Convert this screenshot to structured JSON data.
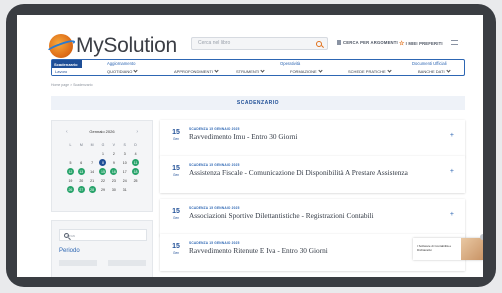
{
  "header": {
    "logo_text": "MySolution",
    "search_placeholder": "Cerca nel libro",
    "links": [
      "CERCA PER ARGOMENTI",
      "I MIEI PREFERITI"
    ]
  },
  "nav": {
    "chip_top": "Scadenzario",
    "chip_bottom": "Lavoro",
    "groups": [
      "Aggiornamento",
      "Operatività",
      "Documenti Ufficiali"
    ],
    "items": [
      "QUOTIDIANO",
      "APPROFONDIMENTI",
      "STRUMENTI",
      "FORMAZIONE",
      "SCHEDE PRATICHE",
      "BANCHE DATI"
    ]
  },
  "breadcrumb": "Home page > Scadenzario",
  "section_title": "SCADENZARIO",
  "calendar": {
    "month": "Gennaio 2026",
    "weekdays": [
      "L",
      "M",
      "M",
      "G",
      "V",
      "S",
      "D"
    ],
    "days": [
      "",
      "",
      "",
      "1",
      "2",
      "3",
      "4",
      "5",
      "6",
      "7",
      "8",
      "9",
      "10",
      "11",
      "12",
      "13",
      "14",
      "15",
      "16",
      "17",
      "18",
      "19",
      "20",
      "21",
      "22",
      "23",
      "24",
      "25",
      "26",
      "27",
      "28",
      "29",
      "30",
      "31",
      ""
    ],
    "today": "8",
    "event_days": [
      "11",
      "12",
      "13",
      "15",
      "16",
      "18",
      "26",
      "27",
      "28"
    ]
  },
  "filter": {
    "placeholder": "Cerca",
    "periodo_label": "Periodo"
  },
  "cards": [
    {
      "day": "15",
      "month": "Gen",
      "kicker": "SCADENZA 15 GENNAIO 2025",
      "title": "Ravvedimento Imu - Entro 30 Giorni"
    },
    {
      "day": "15",
      "month": "Gen",
      "kicker": "SCADENZA 15 GENNAIO 2025",
      "title": "Assistenza Fiscale - Comunicazione Di Disponibilità A Prestare Assistenza"
    },
    {
      "day": "15",
      "month": "Gen",
      "kicker": "SCADENZA 15 GENNAIO 2025",
      "title": "Associazioni Sportive Dilettantistiche - Registrazioni Contabili"
    },
    {
      "day": "15",
      "month": "Gen",
      "kicker": "SCADENZA 15 GENNAIO 2025",
      "title": "Ravvedimento Ritenute E Iva - Entro 30 Giorni"
    }
  ],
  "promo_text": "I Software di Contabilità e Dichiarativi"
}
